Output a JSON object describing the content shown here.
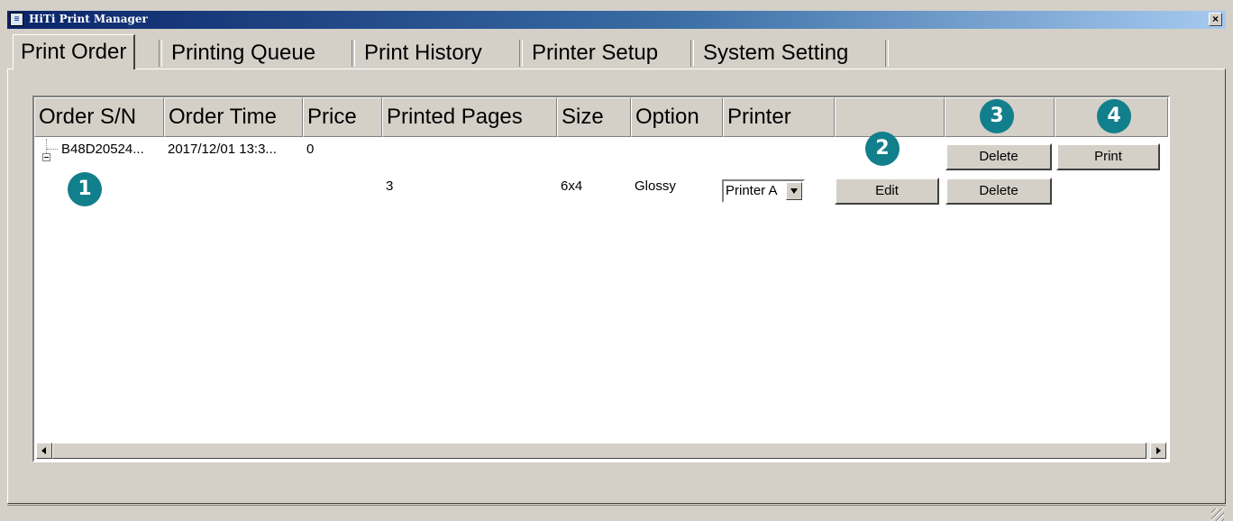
{
  "window": {
    "title": "HiTi Print Manager",
    "close_glyph": "×"
  },
  "tabs": [
    {
      "label": "Print Order"
    },
    {
      "label": "Printing Queue"
    },
    {
      "label": "Print History"
    },
    {
      "label": "Printer Setup"
    },
    {
      "label": "System Setting"
    }
  ],
  "grid": {
    "headers": [
      "Order S/N",
      "Order Time",
      "Price",
      "Printed Pages",
      "Size",
      "Option",
      "Printer",
      "",
      "",
      ""
    ],
    "order_row": {
      "serial": "B48D20524...",
      "time": "2017/12/01 13:3...",
      "price": "0",
      "delete_label": "Delete",
      "print_label": "Print"
    },
    "item_row": {
      "pages": "3",
      "size": "6x4",
      "option": "Glossy",
      "printer": "Printer A",
      "edit_label": "Edit",
      "delete_label": "Delete"
    }
  },
  "annotations": [
    "1",
    "2",
    "3",
    "4"
  ],
  "colors": {
    "badge": "#127f8c",
    "titlebar_start": "#0a246a",
    "titlebar_end": "#a6caf0"
  },
  "icons": {
    "title": "hiti-app-icon",
    "tree": "tree-collapse-icon"
  }
}
